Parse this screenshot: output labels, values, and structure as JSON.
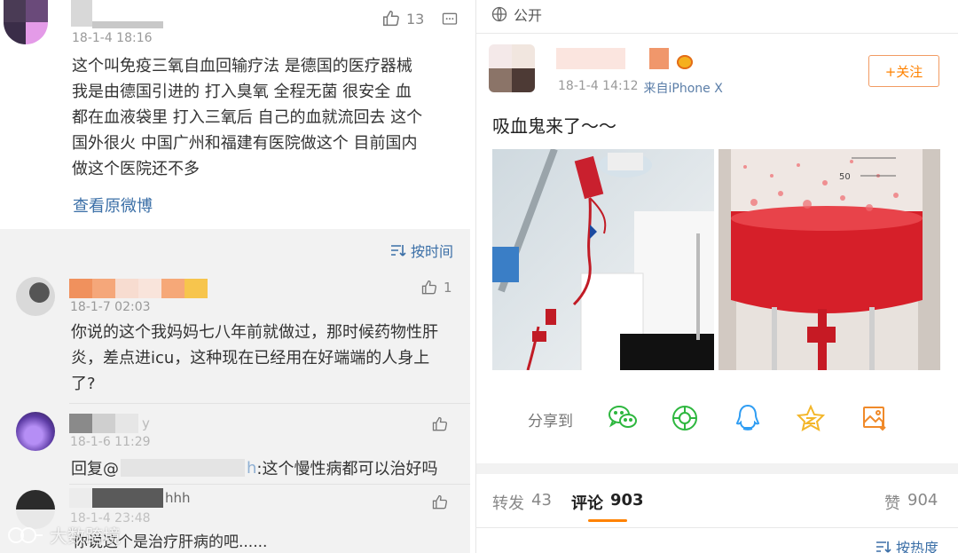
{
  "left": {
    "post": {
      "time": "18-1-4 18:16",
      "likes": "13",
      "text_lines": [
        "这个叫免疫三氧自血回输疗法 是德国的医疗器械",
        "我是由德国引进的 打入臭氧 全程无菌 很安全 血",
        "都在血液袋里 打入三氧后 自己的血就流回去 这个",
        "国外很火 中国广州和福建有医院做这个 目前国内",
        "做这个医院还不多"
      ],
      "view_original": "查看原微博"
    },
    "sort_label": "按时间",
    "comments": [
      {
        "time": "18-1-7 02:03",
        "likes": "1",
        "text_lines": [
          "你说的这个我妈妈七八年前就做过，那时候药物性肝",
          "炎，差点进icu，这种现在已经用在好端端的人身上",
          "了?"
        ]
      },
      {
        "name_tail": "y",
        "time": "18-1-6 11:29",
        "reply_prefix": "回复@",
        "reply_name_tail": "h",
        "reply_text": ":这个慢性病都可以治好吗"
      },
      {
        "name_tail": "hhh",
        "time": "18-1-4 23:48",
        "text": "你说这个是治疗肝病的吧......"
      }
    ],
    "watermark": "大数跨境"
  },
  "right": {
    "visibility": "公开",
    "time": "18-1-4 14:12",
    "source": "来自iPhone X",
    "follow_label": "+关注",
    "text": "吸血鬼来了～～",
    "share_label": "分享到",
    "share_icons": [
      "wechat-icon",
      "moments-icon",
      "qq-icon",
      "qzone-icon",
      "save-image-icon"
    ],
    "tabs": {
      "repost_label": "转发",
      "repost_count": "43",
      "comment_label": "评论",
      "comment_count": "903",
      "like_label": "赞",
      "like_count": "904"
    },
    "sort_label": "按热度"
  },
  "colors": {
    "link": "#3b6fa7",
    "orange": "#ff8200",
    "tab_underline": "#ff8200",
    "share_green": "#2eb73f",
    "share_blue": "#2f9df3",
    "share_yellow": "#f3b62a",
    "share_orange": "#f08a2a"
  }
}
